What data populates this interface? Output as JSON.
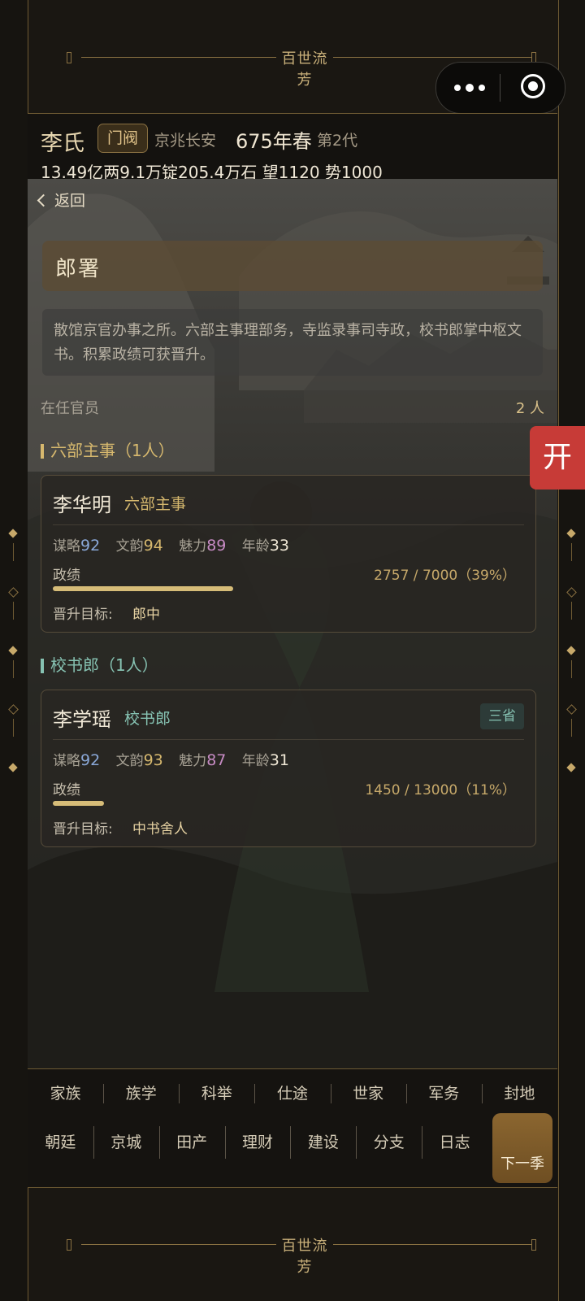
{
  "header_banner": {
    "title": "百世流芳"
  },
  "capsule": {
    "more_icon": "three-dots-icon",
    "close_icon": "target-circle-icon"
  },
  "clan": {
    "surname": "李氏",
    "rank_badge": "门阀",
    "location": "京兆长安",
    "year": "675年春",
    "generation": "第2代",
    "resources": "13.49亿两9.1万锭205.4万石  望1120 势1000"
  },
  "page": {
    "back_label": "返回",
    "office_name": "郎署",
    "description": "散馆京官办事之所。六部主事理部务，寺监录事司寺政，校书郎掌中枢文书。积累政绩可获晋升。",
    "officials_label": "在任官员",
    "officials_count": "2 人"
  },
  "sections": [
    {
      "heading": "六部主事（1人）",
      "official": {
        "name": "李华明",
        "title": "六部主事",
        "tag": "",
        "strategy_label": "谋略",
        "strategy": "92",
        "literary_label": "文韵",
        "literary": "94",
        "charm_label": "魅力",
        "charm": "89",
        "age_label": "年龄",
        "age": "33",
        "merit_label": "政绩",
        "merit_text": "2757 / 7000（39%）",
        "merit_fraction": 0.39,
        "promotion_label": "晋升目标:",
        "promotion_target": "郎中"
      }
    },
    {
      "heading": "校书郎（1人）",
      "official": {
        "name": "李学瑶",
        "title": "校书郎",
        "tag": "三省",
        "strategy_label": "谋略",
        "strategy": "92",
        "literary_label": "文韵",
        "literary": "93",
        "charm_label": "魅力",
        "charm": "87",
        "age_label": "年龄",
        "age": "31",
        "merit_label": "政绩",
        "merit_text": "1450 / 13000（11%）",
        "merit_fraction": 0.11,
        "promotion_label": "晋升目标:",
        "promotion_target": "中书舍人"
      }
    }
  ],
  "side_button": {
    "label": "开"
  },
  "nav": {
    "row1": [
      "家族",
      "族学",
      "科举",
      "仕途",
      "世家",
      "军务",
      "封地"
    ],
    "row2": [
      "朝廷",
      "京城",
      "田产",
      "理财",
      "建设",
      "分支",
      "日志"
    ],
    "next_season": "下一季"
  },
  "footer_banner": {
    "title": "百世流芳"
  },
  "colors": {
    "accent_gold": "#d6b86e",
    "accent_teal": "#86c2b2",
    "danger_red": "#c73b37"
  }
}
